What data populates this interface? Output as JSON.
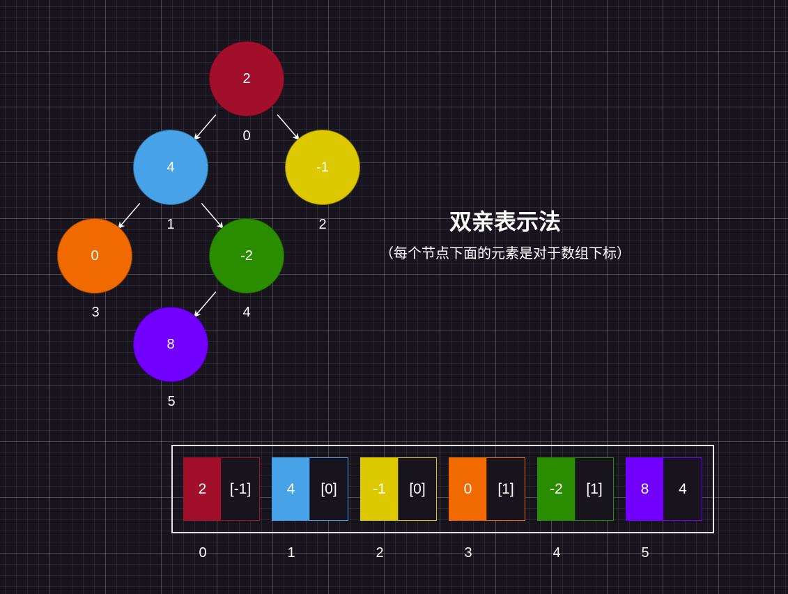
{
  "tree": {
    "nodes": [
      {
        "value": "2",
        "index": "0",
        "color": "#a20f2a"
      },
      {
        "value": "4",
        "index": "1",
        "color": "#47a2e7"
      },
      {
        "value": "-1",
        "index": "2",
        "color": "#ddc900"
      },
      {
        "value": "0",
        "index": "3",
        "color": "#f06a00"
      },
      {
        "value": "-2",
        "index": "4",
        "color": "#2a8d00"
      },
      {
        "value": "8",
        "index": "5",
        "color": "#7100ff"
      }
    ],
    "edges": [
      {
        "from": 0,
        "to": 1
      },
      {
        "from": 0,
        "to": 2
      },
      {
        "from": 1,
        "to": 3
      },
      {
        "from": 1,
        "to": 4
      },
      {
        "from": 4,
        "to": 5
      }
    ],
    "edge_color": "#ffffff"
  },
  "caption": {
    "title": "双亲表示法",
    "subtitle": "（每个节点下面的元素是对于数组下标）"
  },
  "array": {
    "cells": [
      {
        "value": "2",
        "parent": "[-1]",
        "index": "0",
        "color": "#a20f2a"
      },
      {
        "value": "4",
        "parent": "[0]",
        "index": "1",
        "color": "#47a2e7"
      },
      {
        "value": "-1",
        "parent": "[0]",
        "index": "2",
        "color": "#ddc900"
      },
      {
        "value": "0",
        "parent": "[1]",
        "index": "3",
        "color": "#f06a00"
      },
      {
        "value": "-2",
        "parent": "[1]",
        "index": "4",
        "color": "#2a8d00"
      },
      {
        "value": "8",
        "parent": "4",
        "index": "5",
        "color": "#7100ff"
      }
    ],
    "frame_color": "#e6e6e6"
  }
}
